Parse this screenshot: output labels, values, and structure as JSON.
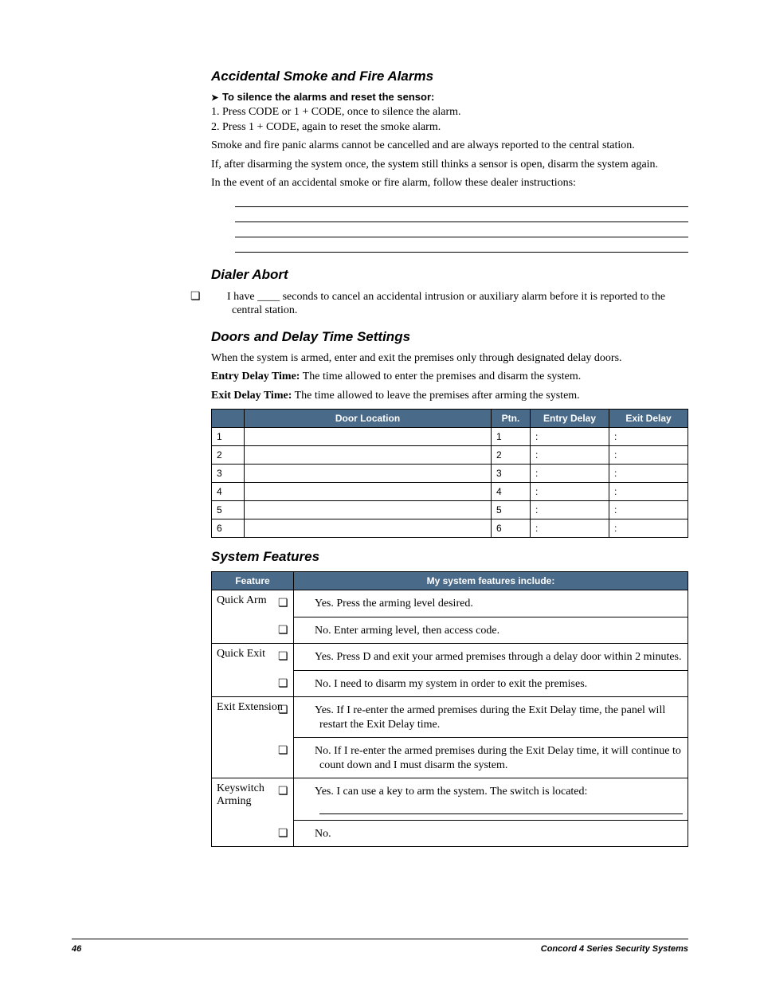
{
  "section_accidental": {
    "heading": "Accidental Smoke and Fire Alarms",
    "subhead": "To silence the alarms and reset the sensor:",
    "steps": [
      "1.   Press CODE or 1 + CODE, once to silence the alarm.",
      "2.   Press 1 + CODE, again to reset the smoke alarm."
    ],
    "p1": "Smoke and fire panic alarms cannot be cancelled and are always reported to the central station.",
    "p2": "If, after disarming the system once, the system still thinks a sensor is open, disarm the system again.",
    "p3": "In the event of an accidental smoke or fire alarm, follow these dealer instructions:"
  },
  "section_dialer": {
    "heading": "Dialer Abort",
    "text": "I have ____ seconds to cancel an accidental intrusion or auxiliary alarm before it is reported to the central station."
  },
  "section_doors": {
    "heading": "Doors and Delay Time Settings",
    "p1": "When the system is armed, enter and exit the premises only through designated delay doors.",
    "entry_label": "Entry Delay Time:",
    "entry_text": " The time allowed to enter the premises and disarm the system.",
    "exit_label": "Exit Delay Time:",
    "exit_text": " The time allowed to leave the premises after arming the system.",
    "table": {
      "headers": {
        "loc": "Door Location",
        "ptn": "Ptn.",
        "entry": "Entry Delay",
        "exit": "Exit Delay"
      },
      "rows": [
        {
          "n": "1",
          "ptn": "1",
          "entry": ":",
          "exit": ":"
        },
        {
          "n": "2",
          "ptn": "2",
          "entry": ":",
          "exit": ":"
        },
        {
          "n": "3",
          "ptn": "3",
          "entry": ":",
          "exit": ":"
        },
        {
          "n": "4",
          "ptn": "4",
          "entry": ":",
          "exit": ":"
        },
        {
          "n": "5",
          "ptn": "5",
          "entry": ":",
          "exit": ":"
        },
        {
          "n": "6",
          "ptn": "6",
          "entry": ":",
          "exit": ":"
        }
      ]
    }
  },
  "section_features": {
    "heading": "System Features",
    "headers": {
      "feature": "Feature",
      "include": "My system features include:"
    },
    "rows": [
      {
        "feature": "Quick Arm",
        "opts": [
          "Yes.  Press the arming level desired.",
          "No.  Enter arming level, then access code."
        ]
      },
      {
        "feature": "Quick Exit",
        "opts": [
          "Yes.  Press D and exit your armed premises through a delay door within 2 minutes.",
          "No.  I need to disarm my system in order to exit the premises."
        ]
      },
      {
        "feature": "Exit Extension",
        "opts": [
          "Yes.  If I re-enter the armed premises during the Exit Delay time, the panel will restart the Exit Delay time.",
          "No.  If I re-enter the armed premises during the Exit Delay time, it will continue to count down and I must disarm the system."
        ]
      },
      {
        "feature": "Keyswitch Arming",
        "opts": [
          "Yes.  I can use a key to arm the system. The switch is located:",
          "No."
        ],
        "has_line_after_first": true
      }
    ]
  },
  "footer": {
    "page": "46",
    "title": "Concord  4 Series Security Systems"
  },
  "checkbox_glyph": "❏"
}
